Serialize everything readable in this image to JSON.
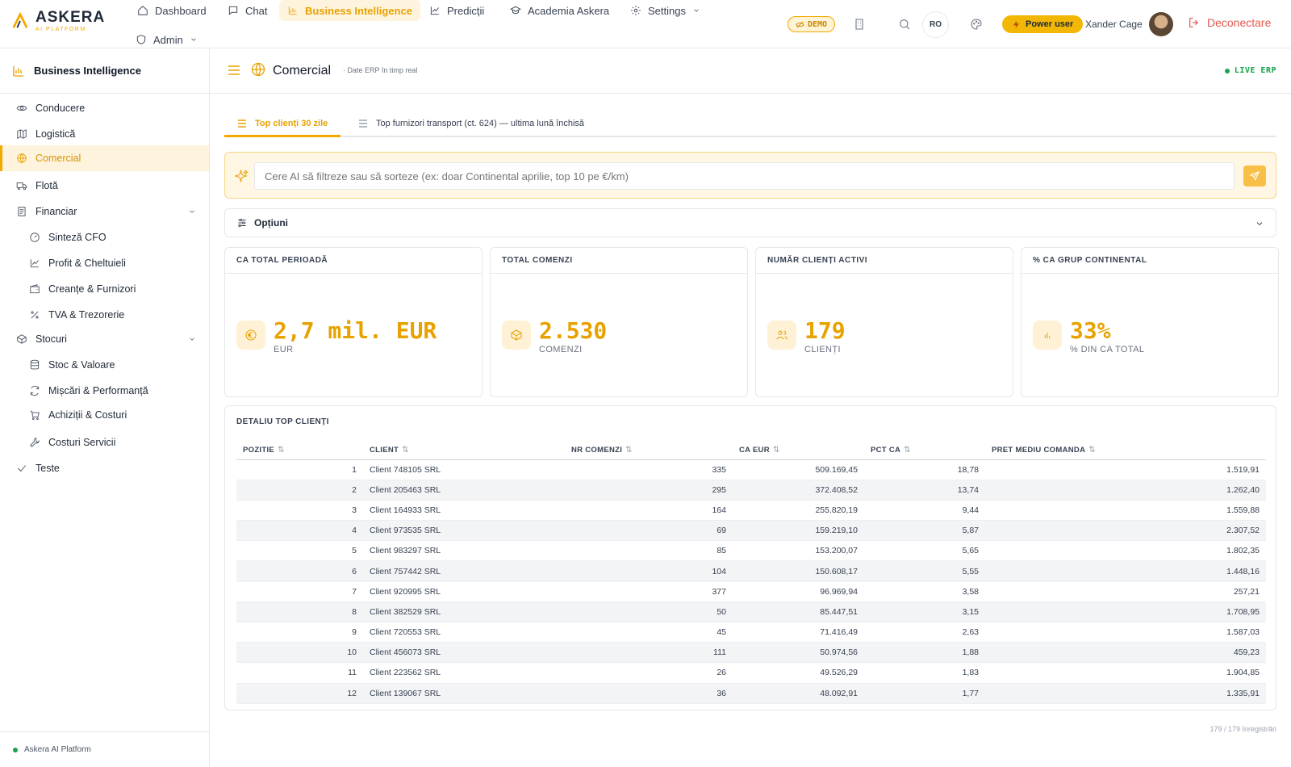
{
  "brand": {
    "name": "ASKERA",
    "sub": "AI PLATFORM"
  },
  "nav": {
    "dashboard": "Dashboard",
    "chat": "Chat",
    "bi": "Business Intelligence",
    "predictii": "Predicții",
    "academia": "Academia Askera",
    "settings": "Settings",
    "admin": "Admin"
  },
  "header": {
    "demo": "DEMO",
    "lang": "RO",
    "power": "Power user",
    "user": "Xander Cage",
    "logout": "Deconectare"
  },
  "sidebar": {
    "title": "Business Intelligence",
    "items": {
      "conducere": "Conducere",
      "logistica": "Logistică",
      "comercial": "Comercial",
      "flota": "Flotă",
      "financiar": "Financiar",
      "sinteza": "Sinteză CFO",
      "profit": "Profit & Cheltuieli",
      "creante": "Creanțe & Furnizori",
      "tva": "TVA & Trezorerie",
      "stocuri": "Stocuri",
      "stoc": "Stoc & Valoare",
      "miscari": "Mișcări & Performanță",
      "achizitii": "Achiziții & Costuri",
      "costuri": "Costuri Servicii",
      "teste": "Teste"
    },
    "footer": "Askera AI Platform"
  },
  "page": {
    "title": "Comercial",
    "subtitle": "· Date ERP în timp real",
    "live": "LIVE ERP"
  },
  "tabs": {
    "tab1": "Top clienți 30 zile",
    "tab2": "Top furnizori transport (ct. 624) — ultima lună închisă"
  },
  "ai": {
    "placeholder": "Cere AI să filtreze sau să sorteze (ex: doar Continental aprilie, top 10 pe €/km)"
  },
  "options": {
    "label": "Opțiuni"
  },
  "kpis": [
    {
      "title": "CA TOTAL PERIOADĂ",
      "value": "2,7 mil. EUR",
      "unit": "EUR"
    },
    {
      "title": "TOTAL COMENZI",
      "value": "2.530",
      "unit": "COMENZI"
    },
    {
      "title": "NUMĂR CLIENȚI ACTIVI",
      "value": "179",
      "unit": "CLIENȚI"
    },
    {
      "title": "% CA GRUP CONTINENTAL",
      "value": "33%",
      "unit": "% DIN CA TOTAL"
    }
  ],
  "table": {
    "title": "DETALIU TOP CLIENȚI",
    "columns": [
      "POZITIE",
      "CLIENT",
      "NR COMENZI",
      "CA EUR",
      "PCT CA",
      "PRET MEDIU COMANDA"
    ],
    "rows": [
      [
        "1",
        "Client 748105 SRL",
        "335",
        "509.169,45",
        "18,78",
        "1.519,91"
      ],
      [
        "2",
        "Client 205463 SRL",
        "295",
        "372.408,52",
        "13,74",
        "1.262,40"
      ],
      [
        "3",
        "Client 164933 SRL",
        "164",
        "255.820,19",
        "9,44",
        "1.559,88"
      ],
      [
        "4",
        "Client 973535 SRL",
        "69",
        "159.219,10",
        "5,87",
        "2.307,52"
      ],
      [
        "5",
        "Client 983297 SRL",
        "85",
        "153.200,07",
        "5,65",
        "1.802,35"
      ],
      [
        "6",
        "Client 757442 SRL",
        "104",
        "150.608,17",
        "5,55",
        "1.448,16"
      ],
      [
        "7",
        "Client 920995 SRL",
        "377",
        "96.969,94",
        "3,58",
        "257,21"
      ],
      [
        "8",
        "Client 382529 SRL",
        "50",
        "85.447,51",
        "3,15",
        "1.708,95"
      ],
      [
        "9",
        "Client 720553 SRL",
        "45",
        "71.416,49",
        "2,63",
        "1.587,03"
      ],
      [
        "10",
        "Client 456073 SRL",
        "111",
        "50.974,56",
        "1,88",
        "459,23"
      ],
      [
        "11",
        "Client 223562 SRL",
        "26",
        "49.526,29",
        "1,83",
        "1.904,85"
      ],
      [
        "12",
        "Client 139067 SRL",
        "36",
        "48.092,91",
        "1,77",
        "1.335,91"
      ]
    ],
    "count": "179 / 179 înregistrări"
  }
}
